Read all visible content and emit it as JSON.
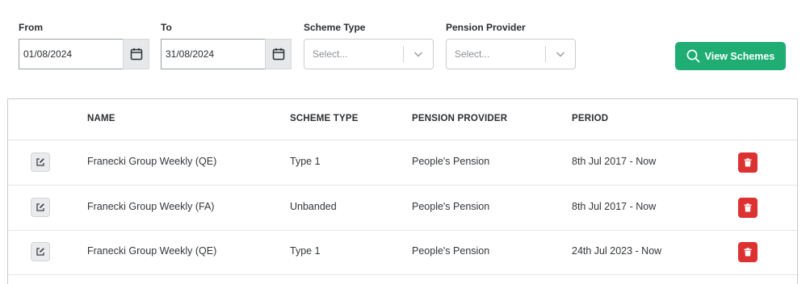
{
  "filters": {
    "from": {
      "label": "From",
      "value": "01/08/2024"
    },
    "to": {
      "label": "To",
      "value": "31/08/2024"
    },
    "scheme_type": {
      "label": "Scheme Type",
      "placeholder": "Select..."
    },
    "pension_provider": {
      "label": "Pension Provider",
      "placeholder": "Select..."
    },
    "view_button": "View Schemes",
    "accent_color": "#1fad74"
  },
  "table": {
    "columns": [
      "NAME",
      "SCHEME TYPE",
      "PENSION PROVIDER",
      "PERIOD"
    ],
    "rows": [
      {
        "name": "Franecki Group Weekly (QE)",
        "scheme_type": "Type 1",
        "provider": "People's Pension",
        "period": "8th Jul 2017 - Now"
      },
      {
        "name": "Franecki Group Weekly (FA)",
        "scheme_type": "Unbanded",
        "provider": "People's Pension",
        "period": "8th Jul 2017 - Now"
      },
      {
        "name": "Franecki Group Weekly (QE)",
        "scheme_type": "Type 1",
        "provider": "People's Pension",
        "period": "24th Jul 2023 - Now"
      }
    ],
    "icons": {
      "edit": "edit-icon",
      "delete": "trash-icon",
      "calendar": "calendar-icon",
      "search": "search-icon"
    },
    "delete_color": "#dc3232"
  }
}
